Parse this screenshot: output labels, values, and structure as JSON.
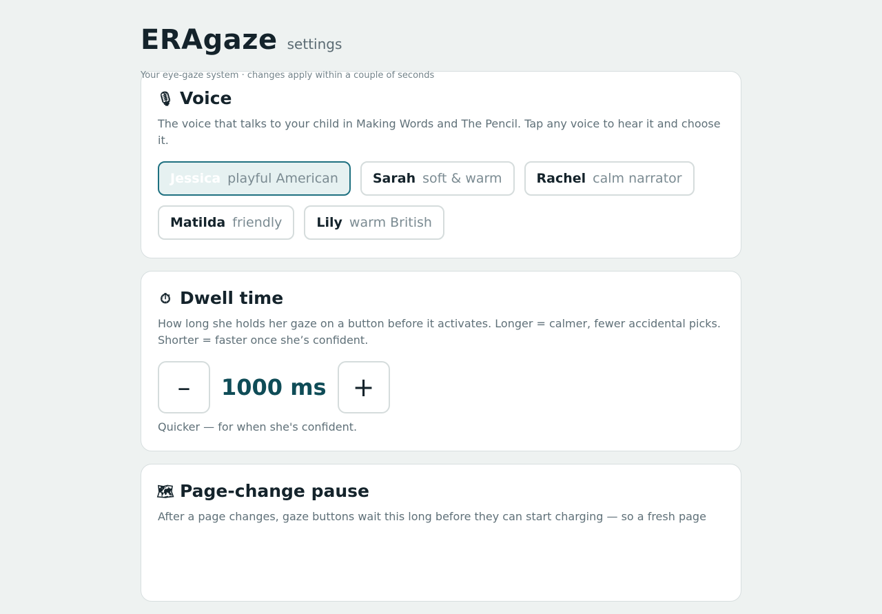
{
  "header": {
    "app_title": "ERAgaze",
    "app_subtitle": "settings",
    "tagline": "Your eye-gaze system · changes apply within a couple of seconds"
  },
  "voice": {
    "icon": "microphone-icon",
    "icon_glyph": "🎙",
    "title": "Voice",
    "description": "The voice that talks to your child in Making Words and The Pencil. Tap any voice to hear it and choose it.",
    "options": [
      {
        "name": "Jessica",
        "desc": "playful American",
        "selected": true
      },
      {
        "name": "Sarah",
        "desc": "soft & warm",
        "selected": false
      },
      {
        "name": "Rachel",
        "desc": "calm narrator",
        "selected": false
      },
      {
        "name": "Matilda",
        "desc": "friendly",
        "selected": false
      },
      {
        "name": "Lily",
        "desc": "warm British",
        "selected": false
      }
    ]
  },
  "dwell": {
    "icon": "stopwatch-icon",
    "icon_glyph": "⏱",
    "title": "Dwell time",
    "description": "How long she holds her gaze on a button before it activates. Longer = calmer, fewer accidental picks. Shorter = faster once she’s confident.",
    "minus_label": "–",
    "plus_label": "+",
    "value": "1000 ms",
    "hint": "Quicker — for when she's confident."
  },
  "pause": {
    "icon": "map-icon",
    "icon_glyph": "🗺",
    "title": "Page-change pause",
    "description": "After a page changes, gaze buttons wait this long before they can start charging — so a fresh page"
  },
  "colors": {
    "accent": "#1e7080",
    "value_color": "#0f4c57",
    "background": "#eef2f1"
  }
}
